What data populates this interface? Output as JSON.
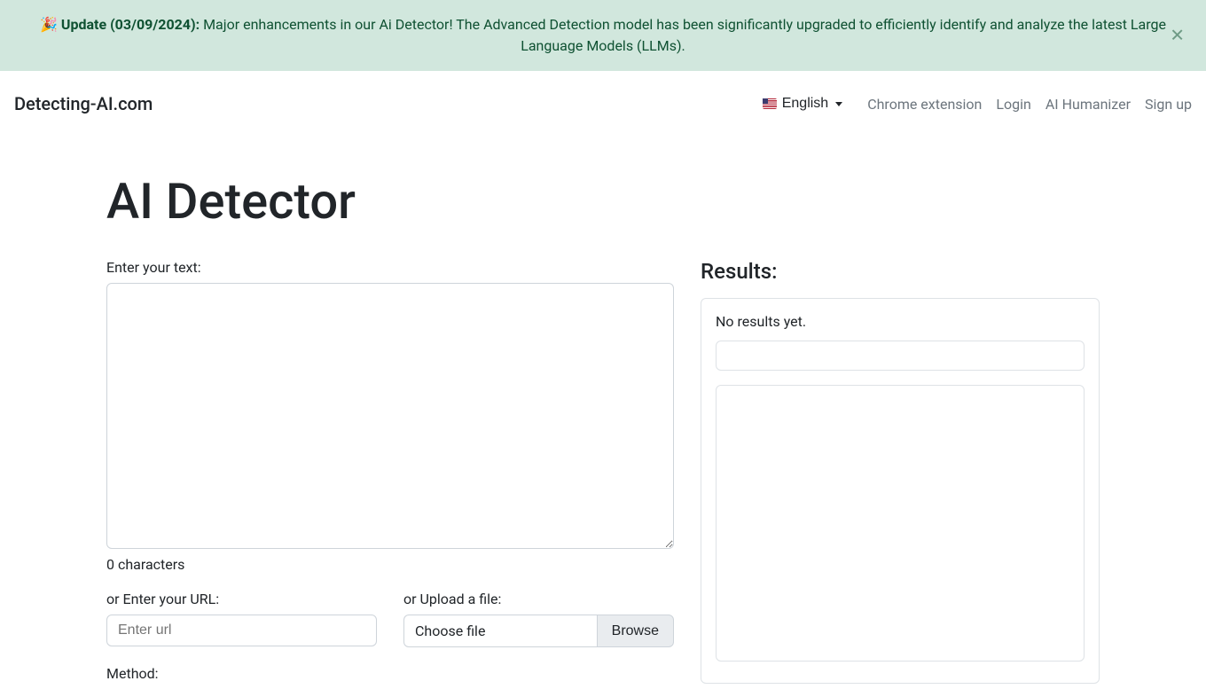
{
  "alert": {
    "emoji": "🎉",
    "bold_prefix": "Update (03/09/2024):",
    "body": " Major enhancements in our Ai Detector! The Advanced Detection model has been significantly upgraded to efficiently identify and analyze the latest Large Language Models (LLMs)."
  },
  "navbar": {
    "brand": "Detecting-AI.com",
    "language": "English",
    "links": {
      "chrome_extension": "Chrome extension",
      "login": "Login",
      "ai_humanizer": "AI Humanizer",
      "sign_up": "Sign up"
    }
  },
  "page": {
    "title": "AI Detector"
  },
  "form": {
    "text_label": "Enter your text:",
    "char_count": "0 characters",
    "url_label": "or Enter your URL:",
    "url_placeholder": "Enter url",
    "file_label": "or Upload a file:",
    "file_choose_text": "Choose file",
    "file_browse_text": "Browse",
    "method_label": "Method:"
  },
  "results": {
    "heading": "Results:",
    "empty_text": "No results yet."
  }
}
